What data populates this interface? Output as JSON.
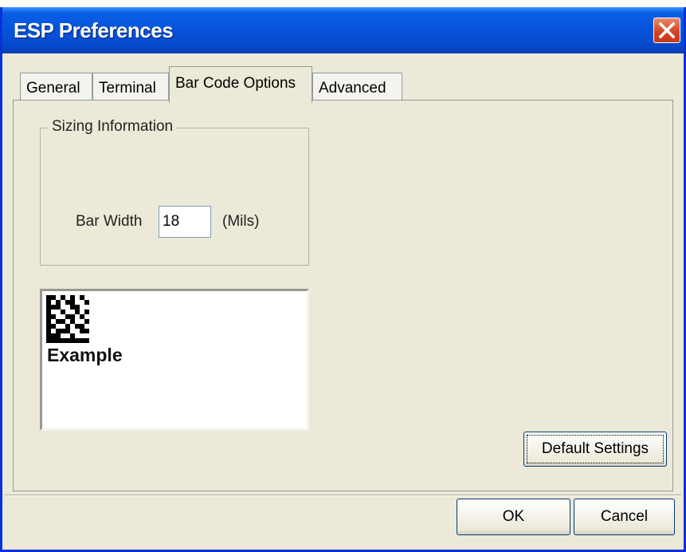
{
  "window": {
    "title": "ESP Preferences",
    "close_icon": "close-icon"
  },
  "tabs": [
    {
      "label": "General",
      "active": false
    },
    {
      "label": "Terminal",
      "active": false
    },
    {
      "label": "Bar Code Options",
      "active": true
    },
    {
      "label": "Advanced",
      "active": false
    }
  ],
  "sizing": {
    "legend": "Sizing Information",
    "bar_width_label": "Bar Width",
    "bar_width_value": "18",
    "unit_label": "(Mils)"
  },
  "preview": {
    "barcode_icon": "datamatrix-barcode",
    "text": "Example"
  },
  "buttons": {
    "default_settings": "Default Settings",
    "ok": "OK",
    "cancel": "Cancel"
  },
  "colors": {
    "titlebar": "#0653dc",
    "dialog_face": "#ece9d8",
    "close_button": "#d1421e"
  }
}
